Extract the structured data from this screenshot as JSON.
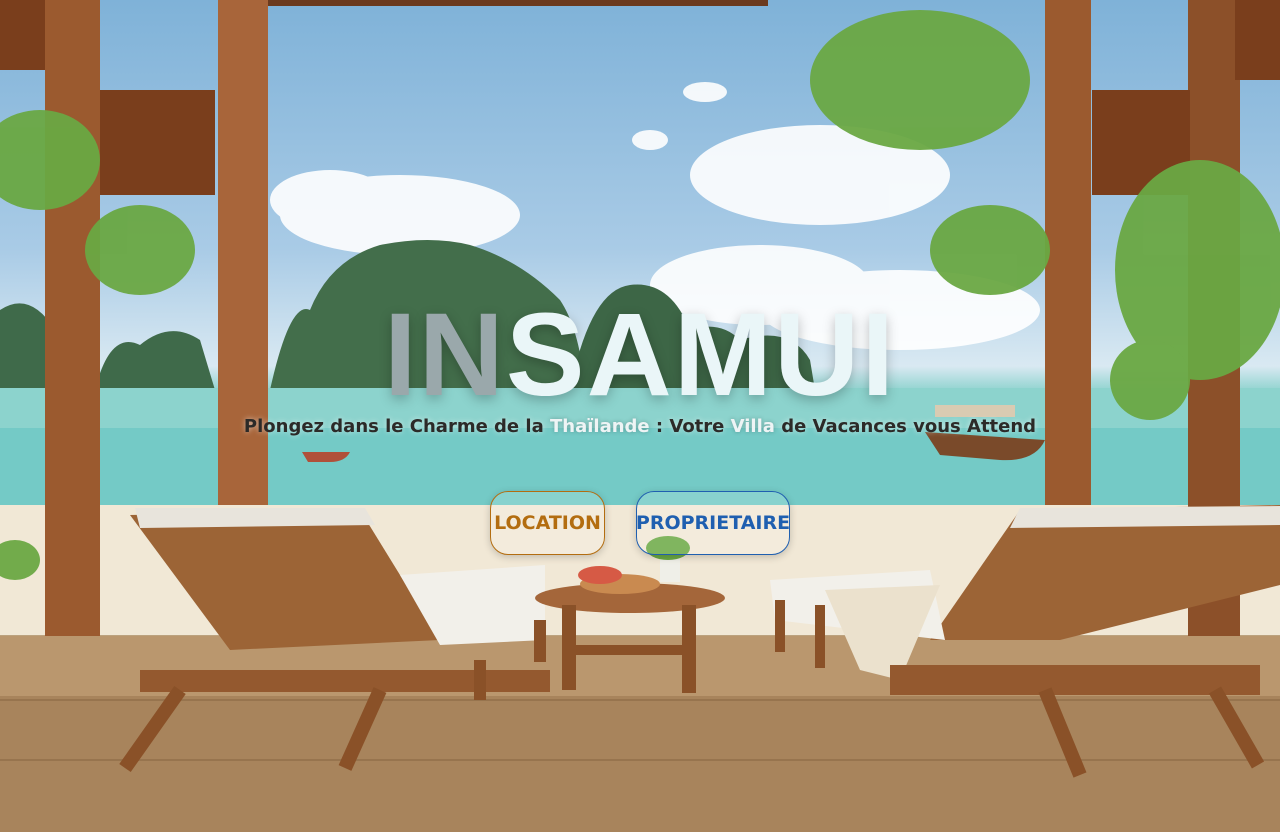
{
  "hero": {
    "brand_part_a": "IN",
    "brand_part_b": "SAMUI",
    "tagline_1": "Plongez dans le Charme de la ",
    "tagline_hl_1": "Thaïlande",
    "tagline_2": " : Votre ",
    "tagline_hl_2": "Villa",
    "tagline_3": " de Vacances vous Attend"
  },
  "actions": {
    "location_label": "LOCATION",
    "owner_label": "PROPRIETAIRE"
  },
  "colors": {
    "location_accent": "#b36d10",
    "owner_accent": "#1f5fb0"
  }
}
